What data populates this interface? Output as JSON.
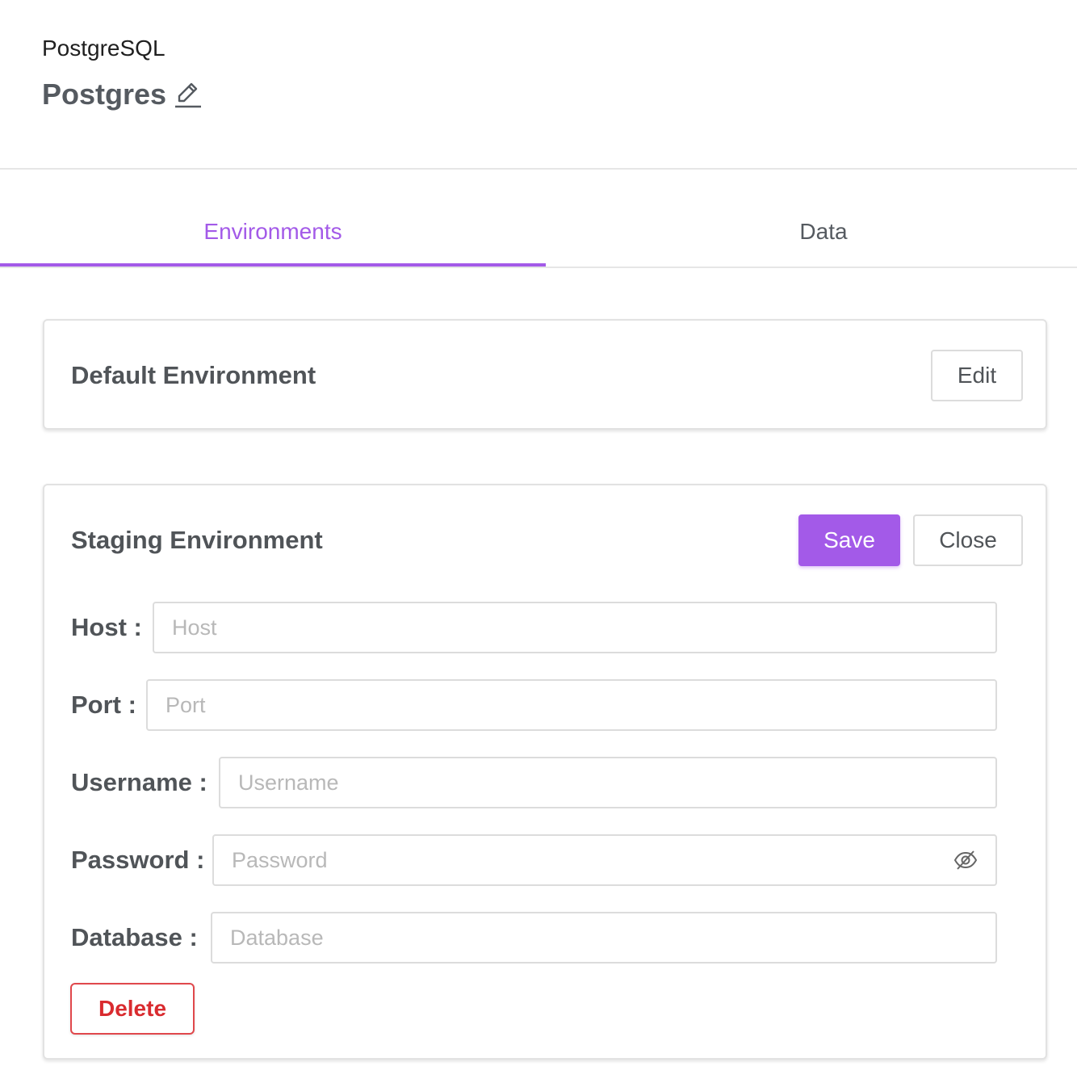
{
  "header": {
    "db_type": "PostgreSQL",
    "name": "Postgres"
  },
  "tabs": [
    {
      "label": "Environments",
      "active": true
    },
    {
      "label": "Data",
      "active": false
    }
  ],
  "default_env": {
    "title": "Default Environment",
    "edit_label": "Edit"
  },
  "staging_env": {
    "title": "Staging Environment",
    "save_label": "Save",
    "close_label": "Close",
    "fields": {
      "host": {
        "label": "Host",
        "placeholder": "Host",
        "value": ""
      },
      "port": {
        "label": "Port",
        "placeholder": "Port",
        "value": ""
      },
      "username": {
        "label": "Username",
        "placeholder": "Username",
        "value": ""
      },
      "password": {
        "label": "Password",
        "placeholder": "Password",
        "value": ""
      },
      "database": {
        "label": "Database",
        "placeholder": "Database",
        "value": ""
      }
    },
    "delete_label": "Delete"
  },
  "colors": {
    "accent": "#a35ae8",
    "danger": "#d92b2f",
    "text": "#505458"
  },
  "icons": {
    "edit_name": "pencil-icon",
    "password_toggle": "eye-off-icon"
  }
}
